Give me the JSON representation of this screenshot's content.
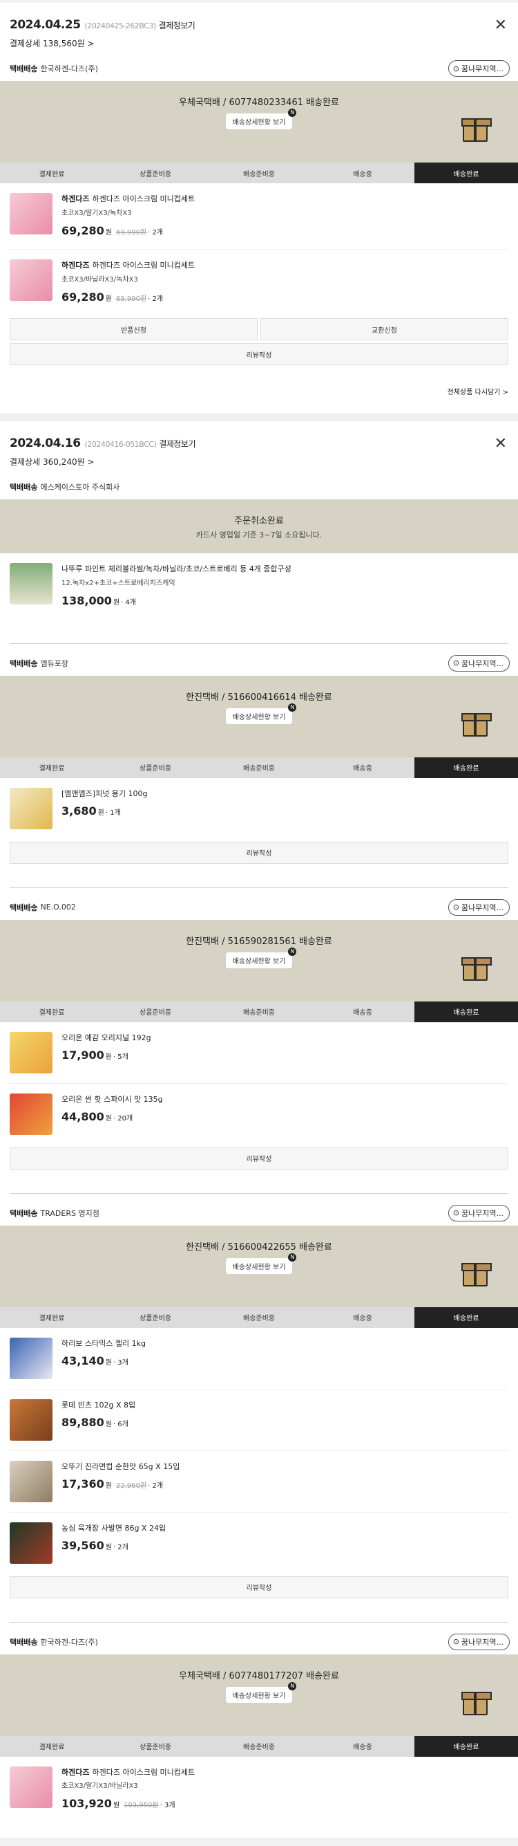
{
  "orders": [
    {
      "date": "2024.04.25",
      "order_no": "(20240425-262BC3)",
      "detail_label": "결제정보기",
      "payment": "결제상세 138,560원",
      "shipments": [
        {
          "label": "택배배송",
          "seller": "한국하겐-다즈(주)",
          "chip": "꿈나무지역...",
          "banner": "우체국택배 / 6077480233461 배송완료",
          "banner_btn": "배송상세현황 보기",
          "items": [
            {
              "brand": "하겐다즈",
              "name": "하겐다즈 아이스크림 미니컵세트",
              "option": "초코X3/딸기X3/녹차X3",
              "price": "69,280",
              "won": "원",
              "original": "69,990원",
              "qty": "· 2개"
            },
            {
              "brand": "하겐다즈",
              "name": "하겐다즈 아이스크림 미니컵세트",
              "option": "초코X3/바닐라X3/녹차X3",
              "price": "69,280",
              "won": "원",
              "original": "69,990원",
              "qty": "· 2개"
            }
          ],
          "buttons": [
            "반품신청",
            "교환신청"
          ],
          "review": "리뷰작성"
        }
      ],
      "cart_all": "전체상품 다시담기 >"
    },
    {
      "date": "2024.04.16",
      "order_no": "(20240416-051BCC)",
      "detail_label": "결제정보기",
      "payment": "결제상세 360,240원",
      "cancel": {
        "label": "택배배송",
        "seller": "에스케이스토아 주식회사",
        "title": "주문취소완료",
        "sub": "카드사 영업일 기준 3~7일 소요됩니다.",
        "item": {
          "brand": "",
          "name": "나뚜루 파인트 체리블라썸/녹차/바닐라/초코/스트로베리 등 4개 종합구성",
          "option": "12.녹차x2+초코+스트로베리치즈케익",
          "price": "138,000",
          "won": "원",
          "qty": "· 4개"
        }
      },
      "shipments": [
        {
          "label": "택배배송",
          "seller": "엠듀포장",
          "chip": "꿈나무지역...",
          "banner": "한진택배 / 516600416614 배송완료",
          "banner_btn": "배송상세현황 보기",
          "items": [
            {
              "brand": "",
              "name": "[엠앤엠즈]피넛 용기 100g",
              "option": "",
              "price": "3,680",
              "won": "원",
              "qty": "· 1개"
            }
          ],
          "review": "리뷰작성"
        },
        {
          "label": "택배배송",
          "seller": "NE.O.002",
          "chip": "꿈나무지역...",
          "banner": "한진택배 / 516590281561 배송완료",
          "banner_btn": "배송상세현황 보기",
          "items": [
            {
              "brand": "",
              "name": "오리온 예감 오리지널 192g",
              "option": "",
              "price": "17,900",
              "won": "원",
              "qty": "· 5개"
            },
            {
              "brand": "",
              "name": "오리온 썬 핫 스파이시 맛 135g",
              "option": "",
              "price": "44,800",
              "won": "원",
              "qty": "· 20개"
            }
          ],
          "review": "리뷰작성"
        },
        {
          "label": "택배배송",
          "seller": "TRADERS 명지점",
          "chip": "꿈나무지역...",
          "banner": "한진택배 / 516600422655 배송완료",
          "banner_btn": "배송상세현황 보기",
          "items": [
            {
              "brand": "",
              "name": "하리보 스타믹스 젤리 1kg",
              "option": "",
              "price": "43,140",
              "won": "원",
              "qty": "· 3개"
            },
            {
              "brand": "",
              "name": "롯데 빈츠 102g X 8입",
              "option": "",
              "price": "89,880",
              "won": "원",
              "qty": "· 6개"
            },
            {
              "brand": "",
              "name": "오뚜기 진라면컵 순한맛 65g X 15입",
              "option": "",
              "price": "17,360",
              "won": "원",
              "original": "22,960원",
              "qty": "· 2개"
            },
            {
              "brand": "",
              "name": "농심 육개장 사발면 86g X 24입",
              "option": "",
              "price": "39,560",
              "won": "원",
              "qty": "· 2개"
            }
          ],
          "review": "리뷰작성"
        },
        {
          "label": "택배배송",
          "seller": "한국하겐-다즈(주)",
          "chip": "꿈나무지역...",
          "banner": "우체국택배 / 6077480177207 배송완료",
          "banner_btn": "배송상세현황 보기",
          "items": [
            {
              "brand": "하겐다즈",
              "name": "하겐다즈 아이스크림 미니컵세트",
              "option": "초코X3/딸기X3/바닐라X3",
              "price": "103,920",
              "won": "원",
              "original": "103,950원",
              "qty": "· 3개"
            }
          ]
        }
      ]
    }
  ],
  "steps": [
    "결제완료",
    "상품준비중",
    "배송준비중",
    "배송중",
    "배송완료"
  ],
  "n_badge": "N",
  "close_glyph": "✕",
  "chevron": ">",
  "pin_icon": "map-pin-icon"
}
